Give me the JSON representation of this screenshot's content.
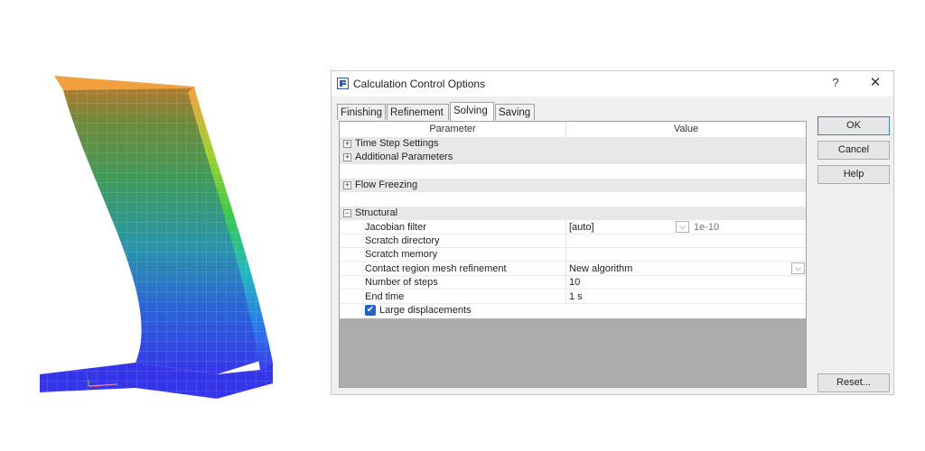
{
  "dialog": {
    "title": "Calculation Control Options",
    "help_glyph": "?",
    "close_glyph": "✕",
    "tabs": [
      {
        "label": "Finishing",
        "active": false
      },
      {
        "label": "Refinement",
        "active": false
      },
      {
        "label": "Solving",
        "active": true
      },
      {
        "label": "Saving",
        "active": false
      }
    ],
    "grid": {
      "header_param": "Parameter",
      "header_value": "Value",
      "groups": {
        "time_step": {
          "label": "Time Step Settings",
          "expander": "+"
        },
        "additional": {
          "label": "Additional Parameters",
          "expander": "+"
        },
        "flow_freezing": {
          "label": "Flow Freezing",
          "expander": "+"
        },
        "structural": {
          "label": "Structural",
          "expander": "−"
        }
      },
      "items": {
        "jacobian": {
          "param": "Jacobian filter",
          "value": "[auto]",
          "extra": "1e-10"
        },
        "scratch_dir": {
          "param": "Scratch directory",
          "value": ""
        },
        "scratch_mem": {
          "param": "Scratch memory",
          "value": ""
        },
        "contact": {
          "param": "Contact region mesh refinement",
          "value": "New algorithm"
        },
        "steps": {
          "param": "Number of steps",
          "value": "10"
        },
        "end_time": {
          "param": "End time",
          "value": "1 s"
        },
        "large_disp": {
          "label": "Large displacements",
          "checked": true
        }
      }
    },
    "buttons": {
      "ok": "OK",
      "cancel": "Cancel",
      "help": "Help",
      "reset": "Reset..."
    }
  },
  "visualization": {
    "icon": "deformed-shell-mesh-image",
    "colors": [
      "#f4a040",
      "#3fc04a",
      "#22b0c8",
      "#3a3aee"
    ]
  }
}
